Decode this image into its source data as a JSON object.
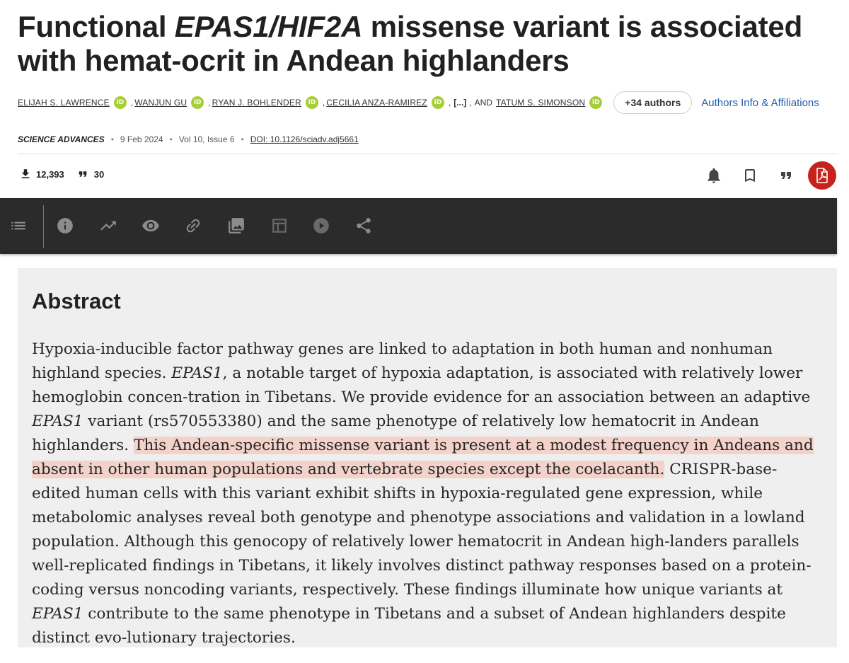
{
  "article": {
    "title_part1": "Functional ",
    "title_gene": "EPAS1/HIF2A",
    "title_part2": " missense variant is associated with hemat-ocrit in Andean highlanders",
    "authors": [
      "Elijah S. Lawrence",
      "Wanjun Gu",
      "Ryan J. Bohlender",
      "Cecilia Anza-Ramirez",
      "[...]",
      "and",
      "Tatum S. Simonson"
    ],
    "orcid_label": "iD",
    "more_authors": "+34 authors",
    "affiliations_link": "Authors Info & Affiliations",
    "journal": "Science Advances",
    "date": "9 Feb 2024",
    "volume": "Vol 10, Issue 6",
    "doi": "DOI: 10.1126/sciadv.adj5661",
    "downloads": "12,393",
    "citations": "30"
  },
  "actions": {
    "icons": [
      "bell-icon",
      "bookmark-icon",
      "quote-icon",
      "pdf-icon"
    ],
    "pdf_color": "#c8221c"
  },
  "toolbar": {
    "icons": [
      "contents-icon",
      "info-icon",
      "metrics-icon",
      "view-icon",
      "link-icon",
      "figures-icon",
      "tables-icon",
      "media-icon",
      "share-icon"
    ]
  },
  "abstract": {
    "heading": "Abstract",
    "s1": "Hypoxia-inducible factor pathway genes are linked to adaptation in both human and nonhuman highland species. ",
    "gene1": "EPAS1",
    "s2": ", a notable target of hypoxia adaptation, is associated with relatively lower hemoglobin concen-tration in Tibetans. We provide evidence for an association between an adaptive ",
    "gene2": "EPAS1",
    "s3": " variant (rs570553380) and the same phenotype of relatively low hematocrit in Andean highlanders. ",
    "highlight": "This Andean-specific missense variant is present at a modest frequency in Andeans and absent in other human populations and vertebrate species except the coelacanth.",
    "s4": " CRISPR-base-edited human cells with this variant exhibit shifts in hypoxia-regulated gene expression, while metabolomic analyses reveal both genotype and phenotype associations and validation in a lowland population. Although this genocopy of relatively lower hematocrit in Andean high-landers parallels well-replicated findings in Tibetans, it likely involves distinct pathway responses based on a protein-coding versus noncoding variants, respectively. These findings illuminate how unique variants at ",
    "gene3": "EPAS1",
    "s5": " contribute to the same phenotype in Tibetans and a subset of Andean highlanders despite distinct evo-lutionary trajectories.",
    "highlight_color": "#f3d2c9"
  }
}
